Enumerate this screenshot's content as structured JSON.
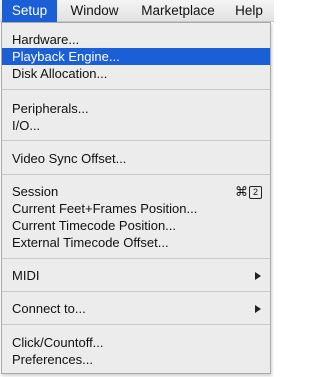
{
  "menubar": {
    "items": [
      {
        "label": "Setup"
      },
      {
        "label": "Window"
      },
      {
        "label": "Marketplace"
      },
      {
        "label": "Help"
      }
    ]
  },
  "setup_menu": {
    "items": [
      {
        "label": "Hardware..."
      },
      {
        "label": "Playback Engine..."
      },
      {
        "label": "Disk Allocation..."
      },
      {
        "label": "Peripherals..."
      },
      {
        "label": "I/O..."
      },
      {
        "label": "Video Sync Offset..."
      },
      {
        "label": "Session",
        "shortcut_symbol": "⌘",
        "shortcut_key": "2"
      },
      {
        "label": "Current Feet+Frames Position..."
      },
      {
        "label": "Current Timecode Position..."
      },
      {
        "label": "External Timecode Offset..."
      },
      {
        "label": "MIDI",
        "submenu_icon": "submenu-arrow-icon"
      },
      {
        "label": "Connect to...",
        "submenu_icon": "submenu-arrow-icon"
      },
      {
        "label": "Click/Countoff..."
      },
      {
        "label": "Preferences..."
      }
    ],
    "highlighted_item": "Playback Engine...",
    "highlight_color": "#1a5fd6"
  }
}
